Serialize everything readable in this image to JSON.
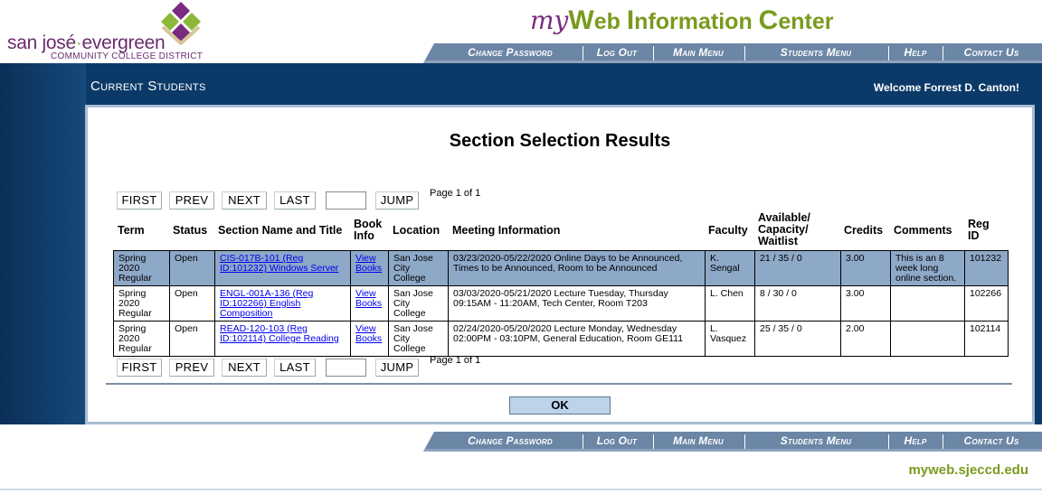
{
  "logo": {
    "line1_a": "san josé",
    "line1_dot": "·",
    "line1_b": "evergreen",
    "line2": "COMMUNITY COLLEGE DISTRICT"
  },
  "brand": {
    "my": "my",
    "w": "W",
    "eb": "eb ",
    "i": "I",
    "nformation": "nformation ",
    "c": "C",
    "enter": "enter"
  },
  "nav": {
    "change_password": "Change Password",
    "log_out": "Log Out",
    "main_menu": "Main Menu",
    "students_menu": "Students Menu",
    "help": "Help",
    "contact_us": "Contact Us"
  },
  "band": {
    "title": "Current Students",
    "welcome": "Welcome Forrest D. Canton!"
  },
  "page_title": "Section Selection Results",
  "pager": {
    "first": "FIRST",
    "prev": "PREV",
    "next": "NEXT",
    "last": "LAST",
    "jump": "JUMP",
    "info": "Page 1 of 1",
    "jump_value": ""
  },
  "columns": {
    "term": "Term",
    "status": "Status",
    "section": "Section Name and Title",
    "book1": "Book",
    "book2": "Info",
    "location": "Location",
    "meeting": "Meeting Information",
    "faculty": "Faculty",
    "avail1": "Available/",
    "avail2": "Capacity/",
    "avail3": "Waitlist",
    "credits": "Credits",
    "comments": "Comments",
    "reg1": "Reg",
    "reg2": "ID"
  },
  "rows": [
    {
      "term1": "Spring",
      "term2": "2020",
      "term3": "Regular",
      "status": "Open",
      "sec1": "CIS-017B-101 (Reg",
      "sec2": "ID:101232) Windows Server",
      "sec3": "",
      "book1": "View",
      "book2": "Books",
      "loc1": "San Jose",
      "loc2": "City",
      "loc3": "College",
      "meet1": "03/23/2020-05/22/2020 Online Days to be Announced,",
      "meet2": "Times to be Announced, Room to be Announced",
      "fac1": "K.",
      "fac2": "Sengal",
      "avail": "21 / 35 / 0",
      "credits": "3.00",
      "com1": "This is an 8",
      "com2": "week long",
      "com3": "online section.",
      "reg": "101232"
    },
    {
      "term1": "Spring",
      "term2": "2020",
      "term3": "Regular",
      "status": "Open",
      "sec1": "ENGL-001A-136 (Reg",
      "sec2": "ID:102266) English",
      "sec3": "Composition",
      "book1": "View",
      "book2": "Books",
      "loc1": "San Jose",
      "loc2": "City",
      "loc3": "College",
      "meet1": "03/03/2020-05/21/2020 Lecture Tuesday, Thursday",
      "meet2": "09:15AM - 11:20AM, Tech Center, Room T203",
      "fac1": "L. Chen",
      "fac2": "",
      "avail": "8 / 30 / 0",
      "credits": "3.00",
      "com1": "",
      "com2": "",
      "com3": "",
      "reg": "102266"
    },
    {
      "term1": "Spring",
      "term2": "2020",
      "term3": "Regular",
      "status": "Open",
      "sec1": "READ-120-103 (Reg",
      "sec2": "ID:102114) College Reading",
      "sec3": "",
      "book1": "View",
      "book2": "Books",
      "loc1": "San Jose",
      "loc2": "City",
      "loc3": "College",
      "meet1": "02/24/2020-05/20/2020 Lecture Monday, Wednesday",
      "meet2": "02:00PM - 03:10PM, General Education, Room GE111",
      "fac1": "L.",
      "fac2": "Vasquez",
      "avail": "25 / 35 / 0",
      "credits": "2.00",
      "com1": "",
      "com2": "",
      "com3": "",
      "reg": "102114"
    }
  ],
  "ok": "OK",
  "footer_link": "myweb.sjeccd.edu",
  "colors": {
    "band": "#0c3a68",
    "nav": "#6c86a6",
    "selected_row": "#8ea8c8",
    "brand_purple": "#7a2a7f",
    "brand_green": "#7a9a1e"
  }
}
